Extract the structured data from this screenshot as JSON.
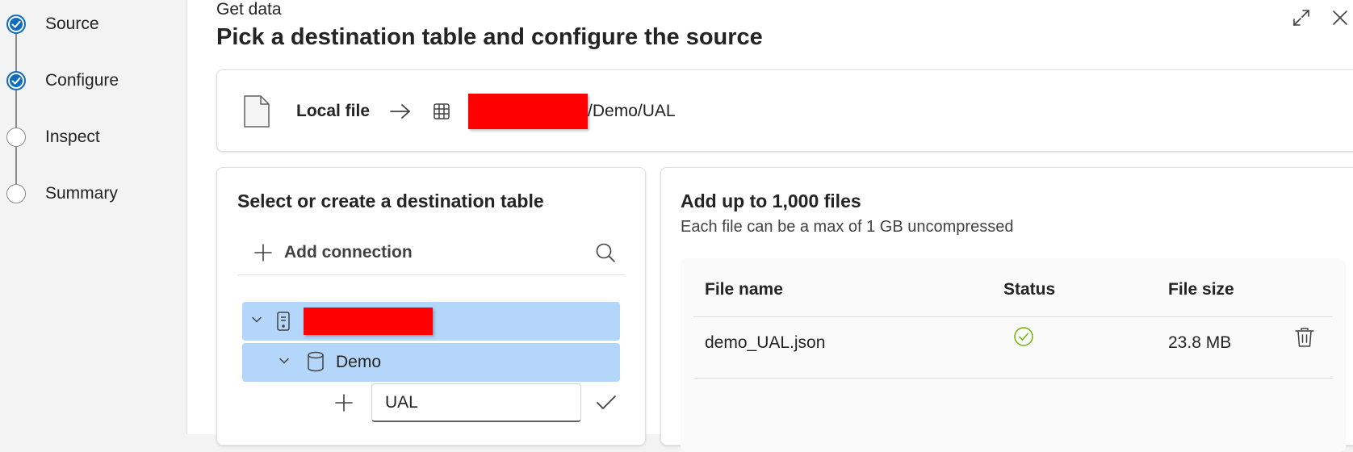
{
  "stepper": {
    "steps": [
      {
        "label": "Source",
        "state": "done"
      },
      {
        "label": "Configure",
        "state": "done"
      },
      {
        "label": "Inspect",
        "state": "todo"
      },
      {
        "label": "Summary",
        "state": "todo"
      }
    ]
  },
  "header": {
    "eyebrow": "Get data",
    "title": "Pick a destination table and configure the source",
    "icons": [
      "expand-icon",
      "close-icon"
    ]
  },
  "path": {
    "source_label": "Local file",
    "path_suffix": "/Demo/UAL"
  },
  "destination": {
    "heading": "Select or create a destination table",
    "add_connection_label": "Add connection",
    "tree": {
      "database_label": "Demo",
      "new_table_value": "UAL"
    }
  },
  "files": {
    "heading": "Add up to 1,000 files",
    "subheading": "Each file can be a max of 1 GB uncompressed",
    "columns": [
      "File name",
      "Status",
      "File size"
    ],
    "rows": [
      {
        "name": "demo_UAL.json",
        "status": "success",
        "size": "23.8 MB"
      }
    ]
  },
  "colors": {
    "accent": "#0f6cbd",
    "selection": "#b4d6fa",
    "redaction": "#ff0000",
    "success": "#6bb700"
  }
}
